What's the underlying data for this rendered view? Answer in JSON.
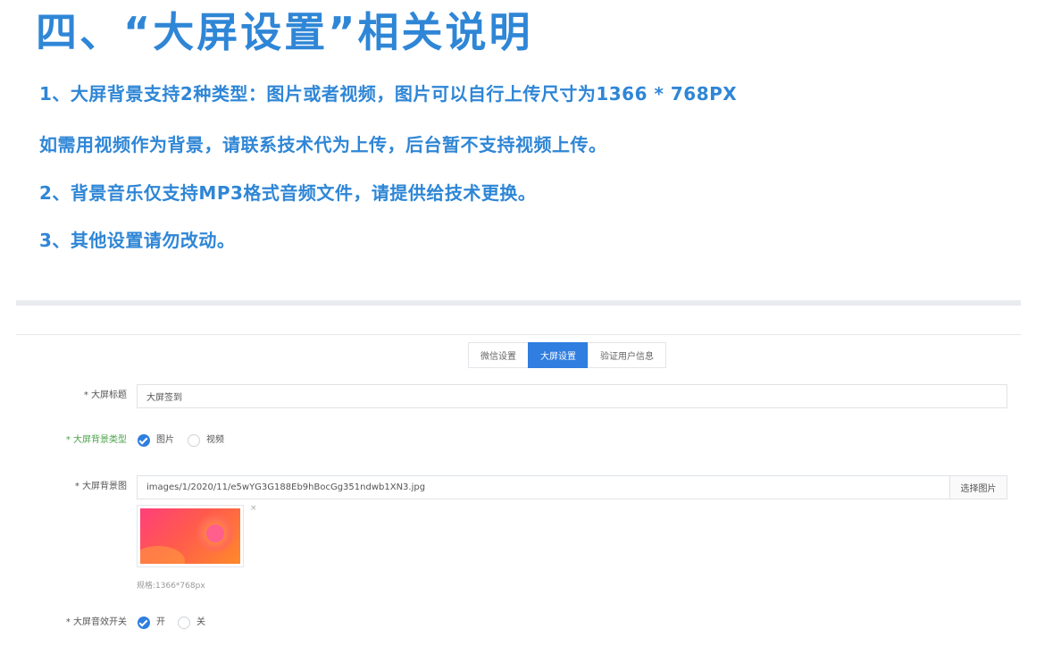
{
  "heading": "四、“大屏设置”相关说明",
  "notes": {
    "line1": "1、大屏背景支持2种类型：图片或者视频，图片可以自行上传尺寸为1366 * 768PX",
    "line2": "如需用视频作为背景，请联系技术代为上传，后台暂不支持视频上传。",
    "line3": "2、背景音乐仅支持MP3格式音频文件，请提供给技术更换。",
    "line4": "3、其他设置请勿改动。"
  },
  "tabs": [
    {
      "label": "微信设置",
      "active": false
    },
    {
      "label": "大屏设置",
      "active": true
    },
    {
      "label": "验证用户信息",
      "active": false
    }
  ],
  "form": {
    "title_label": "* 大屏标题",
    "title_value": "大屏签到",
    "bg_type_label": "* 大屏背景类型",
    "bg_type_options": {
      "image": "图片",
      "video": "视频"
    },
    "bg_type_selected": "图片",
    "bg_image_label": "* 大屏背景图",
    "bg_image_path": "images/1/2020/11/e5wYG3G188Eb9hBocGg351ndwb1XN3.jpg",
    "select_image_button": "选择图片",
    "thumb_close": "×",
    "size_hint": "规格:1366*768px",
    "sound_label": "* 大屏音效开关",
    "sound_options": {
      "on": "开",
      "off": "关"
    },
    "sound_selected": "开"
  },
  "colors": {
    "heading_blue": "#2f86d6",
    "tab_active": "#2f7ee0",
    "required_green": "#4aa24a"
  }
}
